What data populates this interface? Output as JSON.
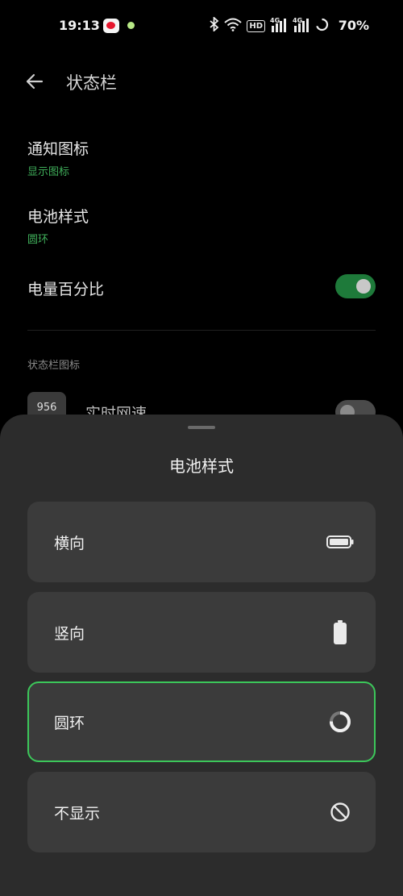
{
  "status_bar": {
    "time": "19:13",
    "network_badge_hd": "HD",
    "signal_1_label": "4G",
    "signal_2_label": "4G",
    "battery_percent": "70%"
  },
  "header": {
    "title": "状态栏"
  },
  "settings": {
    "notification_icons": {
      "title": "通知图标",
      "value": "显示图标"
    },
    "battery_style": {
      "title": "电池样式",
      "value": "圆环"
    },
    "battery_percentage": {
      "title": "电量百分比",
      "enabled": true
    }
  },
  "status_icons_section": {
    "header": "状态栏图标",
    "network_speed": {
      "icon_text": "956",
      "label": "实时网速",
      "enabled": false
    }
  },
  "sheet": {
    "title": "电池样式",
    "options": [
      {
        "label": "横向",
        "icon": "battery-horizontal-icon",
        "selected": false
      },
      {
        "label": "竖向",
        "icon": "battery-vertical-icon",
        "selected": false
      },
      {
        "label": "圆环",
        "icon": "battery-ring-icon",
        "selected": true
      },
      {
        "label": "不显示",
        "icon": "hidden-icon",
        "selected": false
      }
    ]
  },
  "colors": {
    "accent": "#3cc75a",
    "sub_text_green": "#3fae5a",
    "sheet_bg": "#2c2c2c",
    "option_bg": "#3b3b3b"
  }
}
